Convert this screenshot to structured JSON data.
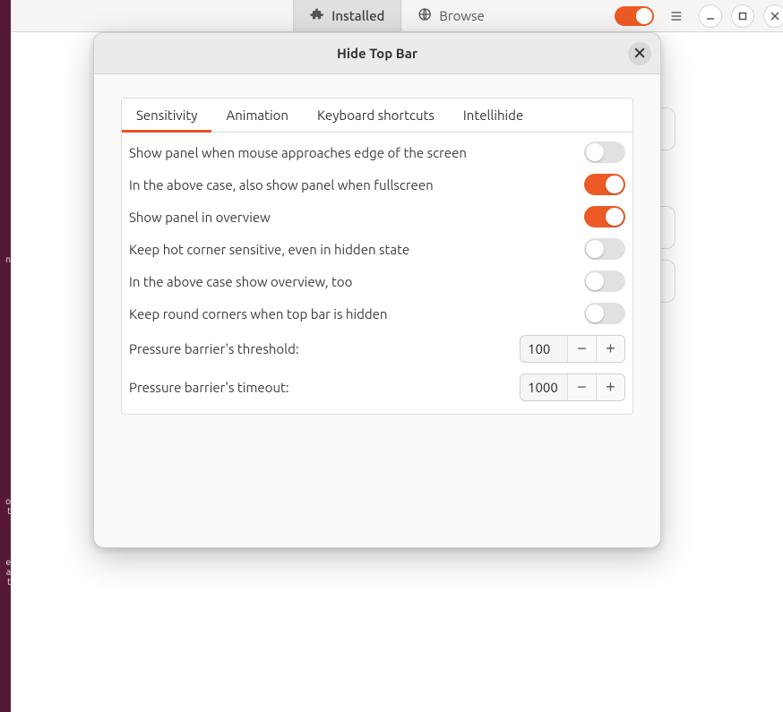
{
  "background": {
    "tabs": {
      "installed": "Installed",
      "browse": "Browse"
    },
    "switch_on": true
  },
  "dialog": {
    "title": "Hide Top Bar",
    "tabs": [
      {
        "label": "Sensitivity",
        "key": "sensitivity",
        "active": true
      },
      {
        "label": "Animation",
        "key": "animation",
        "active": false
      },
      {
        "label": "Keyboard shortcuts",
        "key": "keyboard",
        "active": false
      },
      {
        "label": "Intellihide",
        "key": "intellihide",
        "active": false
      }
    ],
    "toggles": [
      {
        "label": "Show panel when mouse approaches edge of the screen",
        "value": false
      },
      {
        "label": "In the above case, also show panel when fullscreen",
        "value": true
      },
      {
        "label": "Show panel in overview",
        "value": true
      },
      {
        "label": "Keep hot corner sensitive, even in hidden state",
        "value": false
      },
      {
        "label": "In the above case show overview, too",
        "value": false
      },
      {
        "label": "Keep round corners when top bar is hidden",
        "value": false
      }
    ],
    "spinners": [
      {
        "label": "Pressure barrier's threshold:",
        "value": "100"
      },
      {
        "label": "Pressure barrier's timeout:",
        "value": "1000"
      }
    ]
  }
}
